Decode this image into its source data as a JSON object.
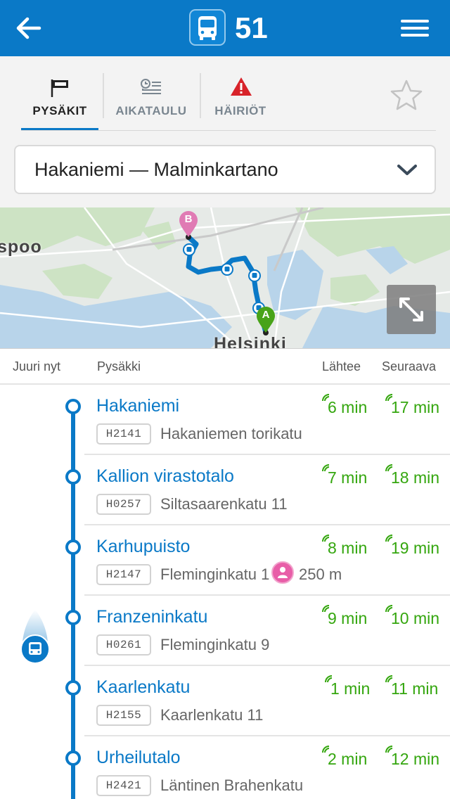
{
  "header": {
    "back_icon": "arrow-left-icon",
    "mode_icon": "bus-icon",
    "route_number": "51",
    "menu_icon": "hamburger-menu-icon"
  },
  "tabs": [
    {
      "label": "PYSÄKIT",
      "icon": "stop-flag-icon",
      "active": true
    },
    {
      "label": "AIKATAULU",
      "icon": "timetable-icon",
      "active": false
    },
    {
      "label": "HÄIRIÖT",
      "icon": "warning-icon",
      "active": false
    }
  ],
  "favorite_icon": "star-outline-icon",
  "route_selector": {
    "value": "Hakaniemi — Malminkartano",
    "icon": "chevron-down-icon"
  },
  "map": {
    "labels": {
      "city_left": "spoo",
      "city_bottom": "Helsinki"
    },
    "marker_start": "A",
    "marker_end": "B",
    "expand_icon": "expand-icon"
  },
  "list_header": {
    "now": "Juuri nyt",
    "stop": "Pysäkki",
    "departs": "Lähtee",
    "next": "Seuraava"
  },
  "stops": [
    {
      "name": "Hakaniemi",
      "code": "H2141",
      "street": "Hakaniemen torikatu",
      "departs": "6 min",
      "next": "17 min"
    },
    {
      "name": "Kallion virastotalo",
      "code": "H0257",
      "street": "Siltasaarenkatu 11",
      "departs": "7 min",
      "next": "18 min"
    },
    {
      "name": "Karhupuisto",
      "code": "H2147",
      "street": "Fleminginkatu 1",
      "departs": "8 min",
      "next": "19 min",
      "walk_distance": "250 m",
      "walk_icon": "person-icon"
    },
    {
      "name": "Franzeninkatu",
      "code": "H0261",
      "street": "Fleminginkatu 9",
      "departs": "9 min",
      "next": "10 min"
    },
    {
      "name": "Kaarlenkatu",
      "code": "H2155",
      "street": "Kaarlenkatu 11",
      "departs": "1 min",
      "next": "11 min"
    },
    {
      "name": "Urheilutalo",
      "code": "H2421",
      "street": "Läntinen Brahenkatu",
      "departs": "2 min",
      "next": "12 min"
    }
  ],
  "realtime_icon": "realtime-signal-icon",
  "vehicle_icon": "bus-vehicle-icon",
  "colors": {
    "primary": "#0a79c7",
    "realtime": "#34a60e",
    "warning": "#d8232a",
    "walk": "#e85ea8",
    "marker_start": "#48a319",
    "marker_end": "#e07bb4"
  }
}
